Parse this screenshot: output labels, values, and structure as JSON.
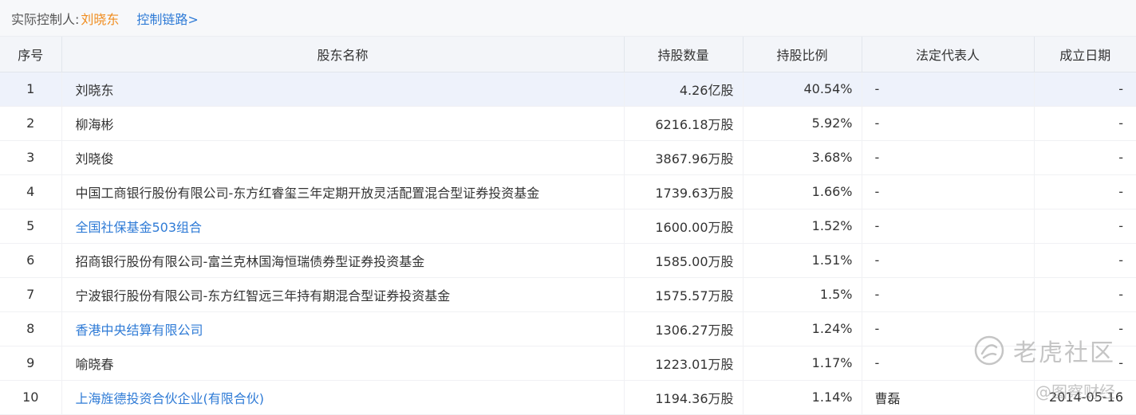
{
  "controller": {
    "label": "实际控制人:",
    "name": "刘晓东",
    "chain_link": "控制链路>"
  },
  "table": {
    "headers": {
      "seq": "序号",
      "name": "股东名称",
      "shares": "持股数量",
      "ratio": "持股比例",
      "rep": "法定代表人",
      "date": "成立日期"
    },
    "rows": [
      {
        "seq": "1",
        "name": "刘晓东",
        "shares": "4.26亿股",
        "ratio": "40.54%",
        "rep": "-",
        "date": "-"
      },
      {
        "seq": "2",
        "name": "柳海彬",
        "shares": "6216.18万股",
        "ratio": "5.92%",
        "rep": "-",
        "date": "-"
      },
      {
        "seq": "3",
        "name": "刘晓俊",
        "shares": "3867.96万股",
        "ratio": "3.68%",
        "rep": "-",
        "date": "-"
      },
      {
        "seq": "4",
        "name": "中国工商银行股份有限公司-东方红睿玺三年定期开放灵活配置混合型证券投资基金",
        "shares": "1739.63万股",
        "ratio": "1.66%",
        "rep": "-",
        "date": "-"
      },
      {
        "seq": "5",
        "name": "全国社保基金503组合",
        "shares": "1600.00万股",
        "ratio": "1.52%",
        "rep": "-",
        "date": "-"
      },
      {
        "seq": "6",
        "name": "招商银行股份有限公司-富兰克林国海恒瑞债券型证券投资基金",
        "shares": "1585.00万股",
        "ratio": "1.51%",
        "rep": "-",
        "date": "-"
      },
      {
        "seq": "7",
        "name": "宁波银行股份有限公司-东方红智远三年持有期混合型证券投资基金",
        "shares": "1575.57万股",
        "ratio": "1.5%",
        "rep": "-",
        "date": "-"
      },
      {
        "seq": "8",
        "name": "香港中央结算有限公司",
        "shares": "1306.27万股",
        "ratio": "1.24%",
        "rep": "-",
        "date": "-"
      },
      {
        "seq": "9",
        "name": "喻晓春",
        "shares": "1223.01万股",
        "ratio": "1.17%",
        "rep": "-",
        "date": "-"
      },
      {
        "seq": "10",
        "name": "上海旌德投资合伙企业(有限合伙)",
        "shares": "1194.36万股",
        "ratio": "1.14%",
        "rep": "曹磊",
        "date": "2014-05-16"
      }
    ]
  },
  "watermark": {
    "brand": "老虎社区",
    "sub": "@图察财经",
    "icon": "tiger-logo-icon"
  },
  "colors": {
    "accent_orange": "#f08c1e",
    "link_blue": "#2f7bd6",
    "header_bg": "#f3f5f9",
    "highlight_row": "#eef2fb"
  }
}
